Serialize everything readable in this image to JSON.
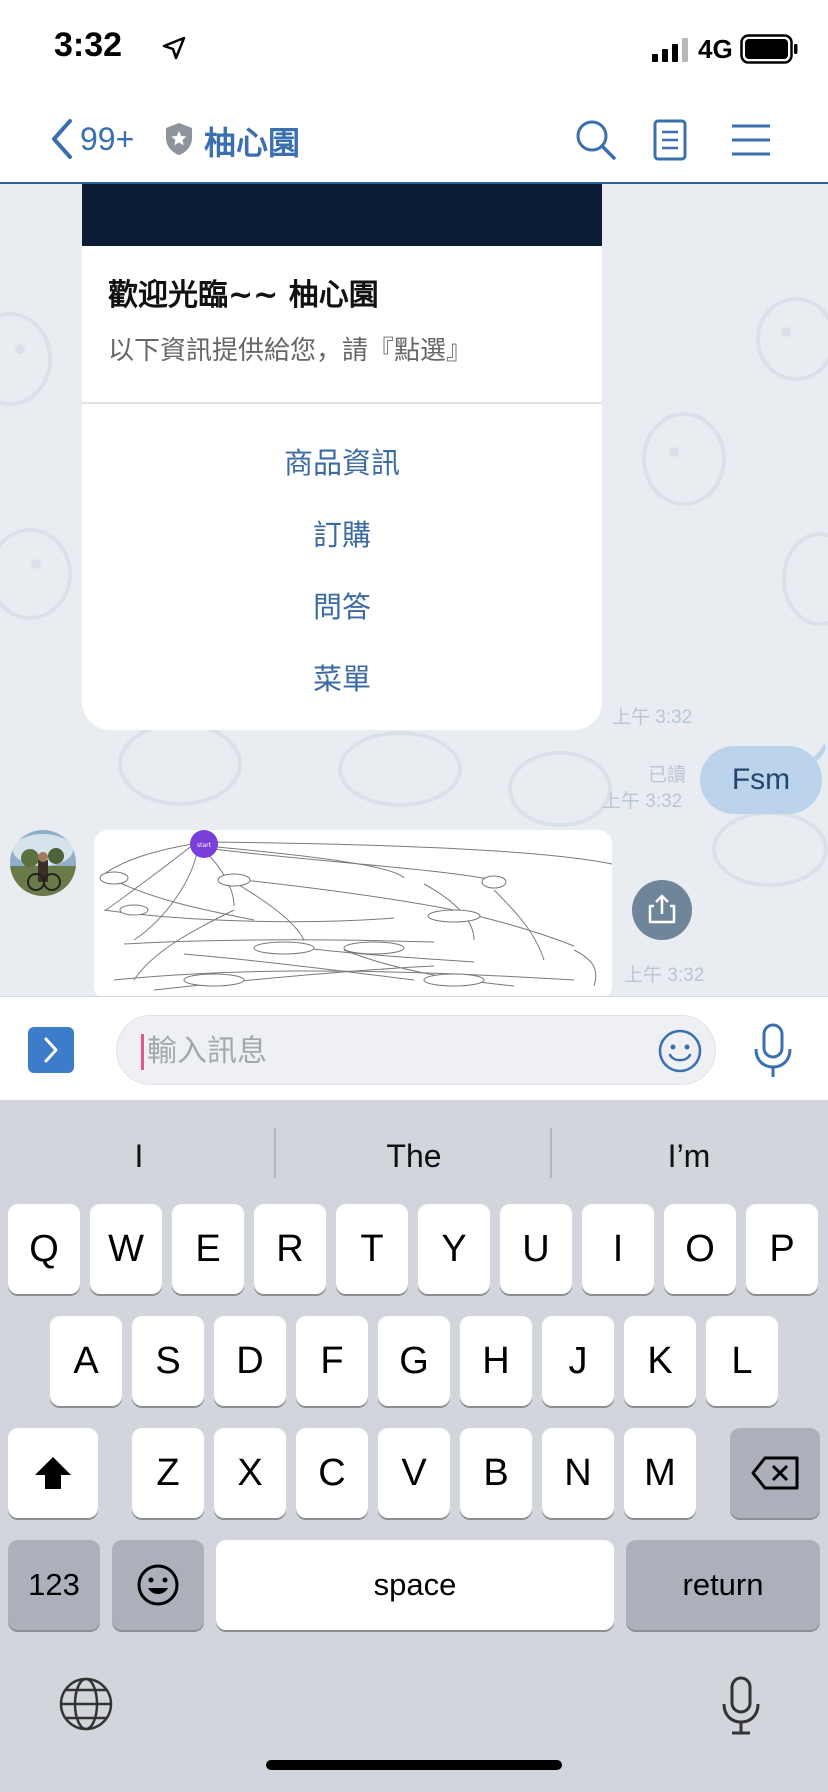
{
  "status_bar": {
    "time": "3:32",
    "network": "4G"
  },
  "nav": {
    "back_count": "99+",
    "title": "柚心園"
  },
  "card": {
    "title": "歡迎光臨~~ 柚心園",
    "subtitle": "以下資訊提供給您，請『點選』",
    "actions": [
      "商品資訊",
      "訂購",
      "問答",
      "菜單"
    ],
    "time": "上午 3:32"
  },
  "my_message": {
    "text": "Fsm",
    "read": "已讀",
    "time": "上午 3:32"
  },
  "image_message": {
    "time": "上午 3:32",
    "node_label": "start"
  },
  "input": {
    "placeholder": "輸入訊息"
  },
  "keyboard": {
    "suggestions": [
      "I",
      "The",
      "I’m"
    ],
    "row1": [
      "Q",
      "W",
      "E",
      "R",
      "T",
      "Y",
      "U",
      "I",
      "O",
      "P"
    ],
    "row2": [
      "A",
      "S",
      "D",
      "F",
      "G",
      "H",
      "J",
      "K",
      "L"
    ],
    "row3": [
      "Z",
      "X",
      "C",
      "V",
      "B",
      "N",
      "M"
    ],
    "numbers_key": "123",
    "space_key": "space",
    "return_key": "return"
  },
  "colors": {
    "accent": "#3a6fb0",
    "bubble_me": "#bcd3ec",
    "banner": "#0c1e36",
    "chat_bg": "#e9edf2"
  }
}
